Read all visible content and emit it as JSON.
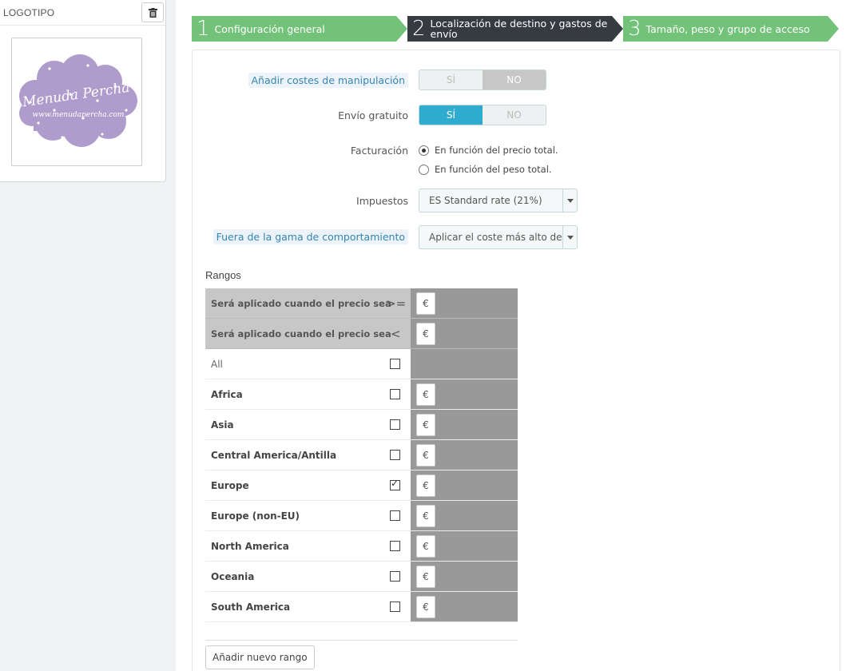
{
  "logo_panel": {
    "title": "LOGOTIPO",
    "logo_text_main": "Menuda Percha",
    "logo_text_url": "www.menudapercha.com"
  },
  "steps": [
    {
      "num": "1",
      "label": "Configuración general"
    },
    {
      "num": "2",
      "label": "Localización de destino y gastos de envío"
    },
    {
      "num": "3",
      "label": "Tamaño, peso y grupo de acceso"
    }
  ],
  "form": {
    "handling": {
      "label": "Añadir costes de manipulación",
      "yes": "SÍ",
      "no": "NO",
      "value": "NO"
    },
    "free_shipping": {
      "label": "Envío gratuito",
      "yes": "SÍ",
      "no": "NO",
      "value": "SÍ"
    },
    "billing": {
      "label": "Facturación",
      "options": [
        "En función del precio total.",
        "En función del peso total."
      ],
      "selected": "En función del precio total."
    },
    "taxes": {
      "label": "Impuestos",
      "value": "ES Standard rate (21%)"
    },
    "out_of_range": {
      "label": "Fuera de la gama de comportamiento",
      "value": "Aplicar el coste más alto de la"
    }
  },
  "ranges": {
    "title": "Rangos",
    "header_ge": {
      "label": "Será aplicado cuando el precio sea",
      "op": ">="
    },
    "header_lt": {
      "label": "Será aplicado cuando el precio sea",
      "op": "<"
    },
    "currency": "€",
    "all_label": "All",
    "zones": [
      {
        "name": "Africa",
        "checked": false
      },
      {
        "name": "Asia",
        "checked": false
      },
      {
        "name": "Central America/Antilla",
        "checked": false
      },
      {
        "name": "Europe",
        "checked": true
      },
      {
        "name": "Europe (non-EU)",
        "checked": false
      },
      {
        "name": "North America",
        "checked": false
      },
      {
        "name": "Oceania",
        "checked": false
      },
      {
        "name": "South America",
        "checked": false
      }
    ],
    "add_button": "Añadir nuevo rango"
  }
}
